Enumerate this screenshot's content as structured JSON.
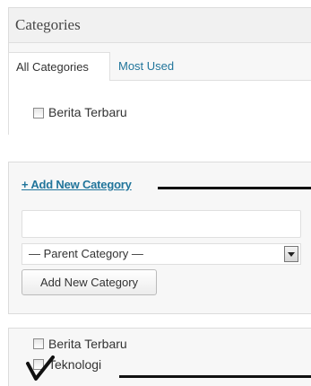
{
  "categories_panel": {
    "title": "Categories",
    "tabs": [
      {
        "label": "All Categories",
        "active": true
      },
      {
        "label": "Most Used",
        "active": false
      }
    ],
    "items": [
      {
        "label": "Berita Terbaru",
        "checked": false
      }
    ]
  },
  "add_category_panel": {
    "link_label": "+ Add New Category",
    "name_input_value": "",
    "parent_select_selected": "— Parent Category —",
    "submit_label": "Add New Category"
  },
  "result_panel": {
    "items": [
      {
        "label": "Berita Terbaru",
        "checked": false
      },
      {
        "label": "Teknologi",
        "checked": true
      }
    ]
  },
  "colors": {
    "link": "#21759b",
    "panel_bg": "#f7f7f7",
    "border": "#dfdfdf",
    "annotation": "#111111"
  },
  "icons": [
    "checkbox-icon",
    "dropdown-arrow-icon",
    "checkmark-annotation-icon"
  ]
}
